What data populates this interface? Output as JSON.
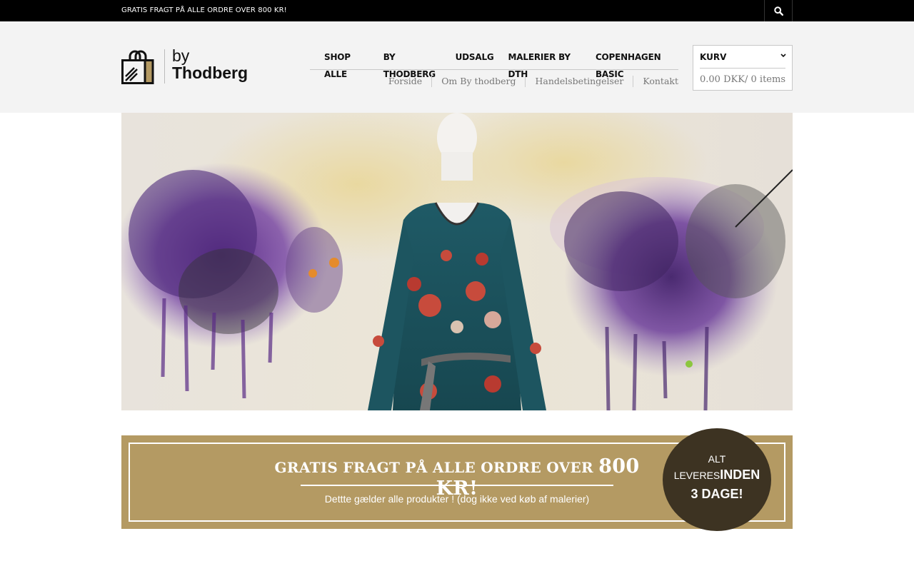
{
  "topbar": {
    "message": "GRATIS FRAGT PÅ ALLE ORDRE OVER 800 KR!",
    "search_icon": "search-icon"
  },
  "logo": {
    "line1": "by",
    "line2": "Thodberg",
    "icon": "shopping-bag-icon",
    "accent": "#b49a63"
  },
  "main_nav": [
    {
      "label": "SHOP ALLE"
    },
    {
      "label": "BY THODBERG"
    },
    {
      "label": "UDSALG"
    },
    {
      "label": "MALERIER BY DTH"
    },
    {
      "label": "COPENHAGEN BASIC"
    }
  ],
  "sub_nav": [
    {
      "label": "Forside"
    },
    {
      "label": "Om By thodberg"
    },
    {
      "label": "Handelsbetingelser"
    },
    {
      "label": "Kontakt"
    }
  ],
  "cart": {
    "title": "KURV",
    "chevron_icon": "chevron-down-icon",
    "total": "0.00 DKK",
    "items": "/ 0 items"
  },
  "hero": {
    "image": "hero-image-dress-on-mannequin"
  },
  "promo": {
    "headline_prefix": "GRATIS FRAGT PÅ ALLE ORDRE OVER ",
    "headline_amount": "800 KR!",
    "subtext": "Dettte gælder alle produkter ! (dog ikke ved køb af malerier)",
    "color": "#b49a63"
  },
  "badge": {
    "line1": "ALT",
    "line2_small": "LEVERES",
    "line2_big": "INDEN",
    "line3": "3 DAGE!",
    "color": "#3d3322"
  }
}
